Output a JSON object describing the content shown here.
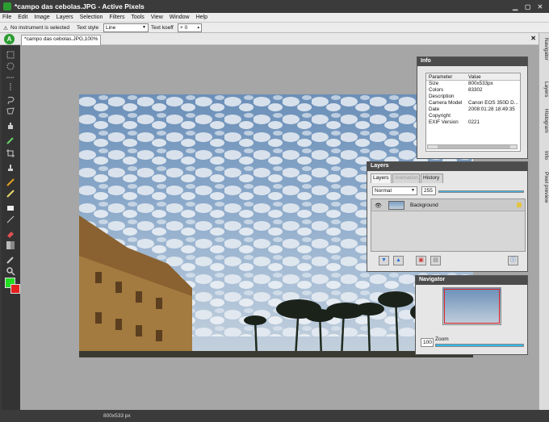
{
  "window": {
    "title": "*campo das cebolas.JPG - Active Pixels"
  },
  "menu": [
    "File",
    "Edit",
    "Image",
    "Layers",
    "Selection",
    "Filters",
    "Tools",
    "View",
    "Window",
    "Help"
  ],
  "options": {
    "status": "No instrument is selected",
    "text_style_label": "Text style",
    "text_style_value": "Line",
    "text_koeff_label": "Text koeff",
    "text_koeff_value": "+ 0"
  },
  "tabbar": {
    "logo": "A",
    "document_tab": "*campo das cebolas.JPG,100%"
  },
  "colors": {
    "foreground": "#22dd22",
    "background": "#e61f1f",
    "accent": "#2c9d31",
    "slider": "#37b7e8"
  },
  "dock_tabs": [
    "Navigator",
    "Layers",
    "Histogram",
    "Info",
    "Pixel preview"
  ],
  "info": {
    "title": "Info",
    "headers": [
      "Parameter",
      "Value"
    ],
    "rows": [
      {
        "k": "Size",
        "v": "800x533px"
      },
      {
        "k": "Colors",
        "v": "83302"
      },
      {
        "k": "Description",
        "v": ""
      },
      {
        "k": "Camera Model",
        "v": "Canon EOS 350D D..."
      },
      {
        "k": "Date",
        "v": "2008:01:28 18:49:35"
      },
      {
        "k": "Copyright",
        "v": ""
      },
      {
        "k": "EXIF Version",
        "v": "0221"
      }
    ]
  },
  "layers": {
    "title": "Layers",
    "tabs": [
      "Layers",
      "Animation",
      "History"
    ],
    "blend_mode": "Normal",
    "opacity": "255",
    "items": [
      {
        "name": "Background"
      }
    ]
  },
  "navigator": {
    "title": "Navigator",
    "zoom_value": "100",
    "zoom_label": "Zoom"
  },
  "status": {
    "dimensions": "800x533 px"
  }
}
